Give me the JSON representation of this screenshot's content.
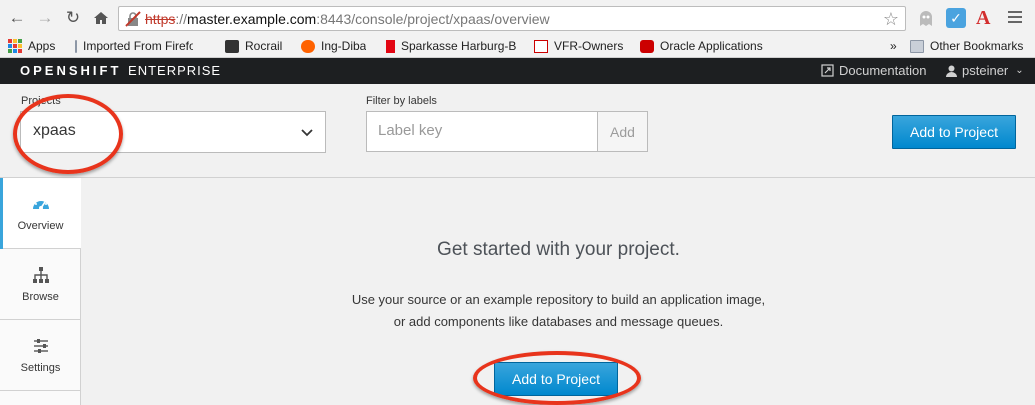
{
  "browser": {
    "url_scheme": "https",
    "url_sep": "://",
    "url_host": "master.example.com",
    "url_path": ":8443/console/project/xpaas/overview",
    "bookmarks": [
      {
        "label": "Apps",
        "icon": "apps-grid-icon"
      },
      {
        "label": "Imported From Firefo",
        "icon": "folder-icon"
      },
      {
        "label": "Rocrail",
        "icon": "train-icon"
      },
      {
        "label": "Ing-Diba",
        "icon": "lion-icon"
      },
      {
        "label": "Sparkasse Harburg-B",
        "icon": "sparkasse-icon"
      },
      {
        "label": "VFR-Owners",
        "icon": "vfr-icon"
      },
      {
        "label": "Oracle Applications",
        "icon": "redhat-icon"
      }
    ],
    "overflow": "»",
    "other_bookmarks": "Other Bookmarks"
  },
  "header": {
    "brand_bold": "OPENSHIFT",
    "brand_light": "ENTERPRISE",
    "documentation": "Documentation",
    "user": "psteiner"
  },
  "projectbar": {
    "projects_label": "Projects",
    "selected_project": "xpaas",
    "filter_label": "Filter by labels",
    "filter_placeholder": "Label key",
    "filter_add": "Add",
    "add_to_project": "Add to Project"
  },
  "sidebar": {
    "items": [
      {
        "label": "Overview",
        "icon": "dashboard-icon",
        "active": true
      },
      {
        "label": "Browse",
        "icon": "sitemap-icon",
        "active": false
      },
      {
        "label": "Settings",
        "icon": "sliders-icon",
        "active": false
      }
    ]
  },
  "main": {
    "title": "Get started with your project.",
    "line1": "Use your source or an example repository to build an application image,",
    "line2": "or add components like databases and message queues.",
    "button": "Add to Project"
  },
  "colors": {
    "accent": "#0088ce",
    "annotation": "#e8341c",
    "header_bg": "#1d1f21"
  }
}
